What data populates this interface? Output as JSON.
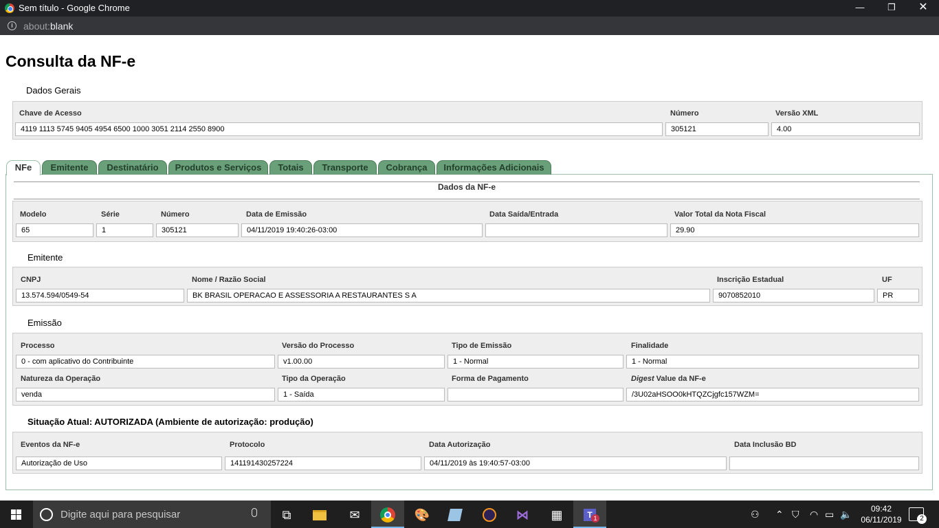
{
  "browser": {
    "window_title": "Sem título - Google Chrome",
    "url_prefix": "about:",
    "url_host": "blank",
    "minimize": "—",
    "maximize": "❐",
    "close": "✕"
  },
  "page": {
    "title": "Consulta da NF-e"
  },
  "dados_gerais": {
    "legend": "Dados Gerais",
    "chave_label": "Chave de Acesso",
    "chave_value": "4119 1113 5745 9405 4954 6500 1000 3051 2114 2550 8900",
    "numero_label": "Número",
    "numero_value": "305121",
    "versao_label": "Versão XML",
    "versao_value": "4.00"
  },
  "tabs": [
    {
      "label": "NFe",
      "active": true
    },
    {
      "label": "Emitente"
    },
    {
      "label": "Destinatário"
    },
    {
      "label": "Produtos e Serviços"
    },
    {
      "label": "Totais"
    },
    {
      "label": "Transporte"
    },
    {
      "label": "Cobrança"
    },
    {
      "label": "Informações Adicionais"
    }
  ],
  "dados_nfe": {
    "heading": "Dados da NF-e",
    "modelo_label": "Modelo",
    "modelo_value": "65",
    "serie_label": "Série",
    "serie_value": "1",
    "numero_label": "Número",
    "numero_value": "305121",
    "emissao_label": "Data de Emissão",
    "emissao_value": "04/11/2019 19:40:26-03:00",
    "saida_label": "Data Saída/Entrada",
    "saida_value": "",
    "valor_label": "Valor Total da Nota Fiscal",
    "valor_value": "29.90"
  },
  "emitente": {
    "legend": "Emitente",
    "cnpj_label": "CNPJ",
    "cnpj_value": "13.574.594/0549-54",
    "nome_label": "Nome / Razão Social",
    "nome_value": "BK BRASIL OPERACAO E ASSESSORIA A RESTAURANTES S A",
    "ie_label": "Inscrição Estadual",
    "ie_value": "9070852010",
    "uf_label": "UF",
    "uf_value": "PR"
  },
  "emissao": {
    "legend": "Emissão",
    "processo_label": "Processo",
    "processo_value": "0 - com aplicativo do Contribuinte",
    "versao_label": "Versão do Processo",
    "versao_value": "v1.00.00",
    "tipo_emissao_label": "Tipo de Emissão",
    "tipo_emissao_value": "1 - Normal",
    "finalidade_label": "Finalidade",
    "finalidade_value": "1 - Normal",
    "natureza_label": "Natureza da Operação",
    "natureza_value": "venda",
    "tipo_operacao_label": "Tipo da Operação",
    "tipo_operacao_value": "1 - Saída",
    "pagamento_label": "Forma de Pagamento",
    "pagamento_value": "",
    "digest_label_italic": "Digest",
    "digest_label_rest": " Value da NF-e",
    "digest_value": "/3U02aHSOO0kHTQZCjgfc157WZM="
  },
  "situacao": {
    "legend": "Situação Atual: AUTORIZADA (Ambiente de autorização: produção)",
    "eventos_label": "Eventos da NF-e",
    "eventos_value": "Autorização de Uso",
    "protocolo_label": "Protocolo",
    "protocolo_value": "141191430257224",
    "data_aut_label": "Data Autorização",
    "data_aut_value": "04/11/2019 às 19:40:57-03:00",
    "data_bd_label": "Data Inclusão BD",
    "data_bd_value": ""
  },
  "taskbar": {
    "search_placeholder": "Digite aqui para pesquisar",
    "time": "09:42",
    "date": "06/11/2019",
    "notification_count": "2",
    "teams_badge": "1"
  }
}
